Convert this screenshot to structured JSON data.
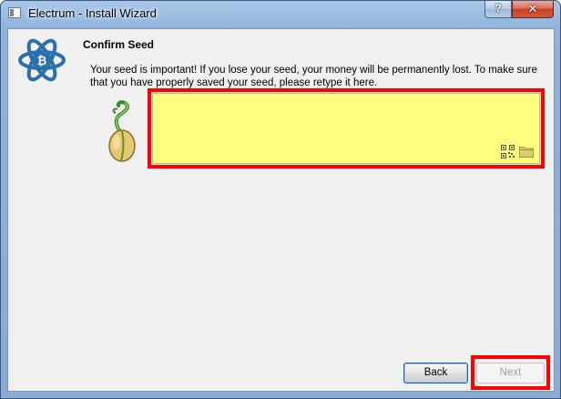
{
  "window": {
    "title": "Electrum  -  Install Wizard",
    "help_glyph": "?",
    "close_glyph": "✕"
  },
  "page": {
    "title": "Confirm Seed",
    "message": "Your seed is important! If you lose your seed, your money will be permanently lost. To make sure that you have properly saved your seed, please retype it here."
  },
  "seed_input": {
    "value": "",
    "placeholder": "",
    "background": "#ffff80"
  },
  "icons": {
    "logo": "electrum-logo-icon",
    "seed": "seed-sprout-icon",
    "qr": "qr-code-icon",
    "folder": "folder-icon"
  },
  "buttons": {
    "back": "Back",
    "next": "Next"
  },
  "colors": {
    "accent": "#2c6fad",
    "highlight": "#ff0000"
  }
}
